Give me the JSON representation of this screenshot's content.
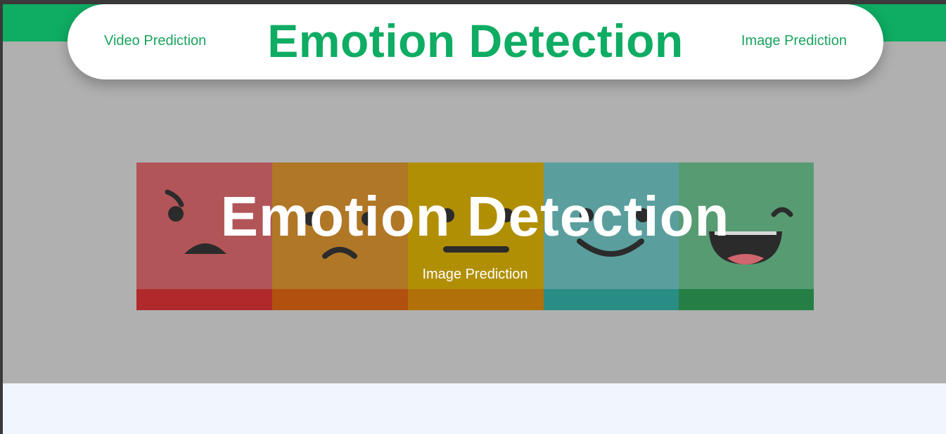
{
  "nav": {
    "left_link": "Video Prediction",
    "brand": "Emotion Detection",
    "right_link": "Image Prediction"
  },
  "hero": {
    "title": "Emotion Detection",
    "link": "Image Prediction"
  },
  "banner": {
    "faces": [
      {
        "name": "angry-face",
        "color": "#b25558",
        "strip": "#b02a2c"
      },
      {
        "name": "sad-face",
        "color": "#b07726",
        "strip": "#b2510f"
      },
      {
        "name": "neutral-face",
        "color": "#b18f05",
        "strip": "#b1700a"
      },
      {
        "name": "happy-face",
        "color": "#5a9f9d",
        "strip": "#2a8d85"
      },
      {
        "name": "laughing-face",
        "color": "#579b72",
        "strip": "#257f45"
      }
    ]
  },
  "colors": {
    "brand_green": "#0fac63",
    "hero_bg": "#b0b0b0",
    "page_bg": "#f1f5fd"
  }
}
